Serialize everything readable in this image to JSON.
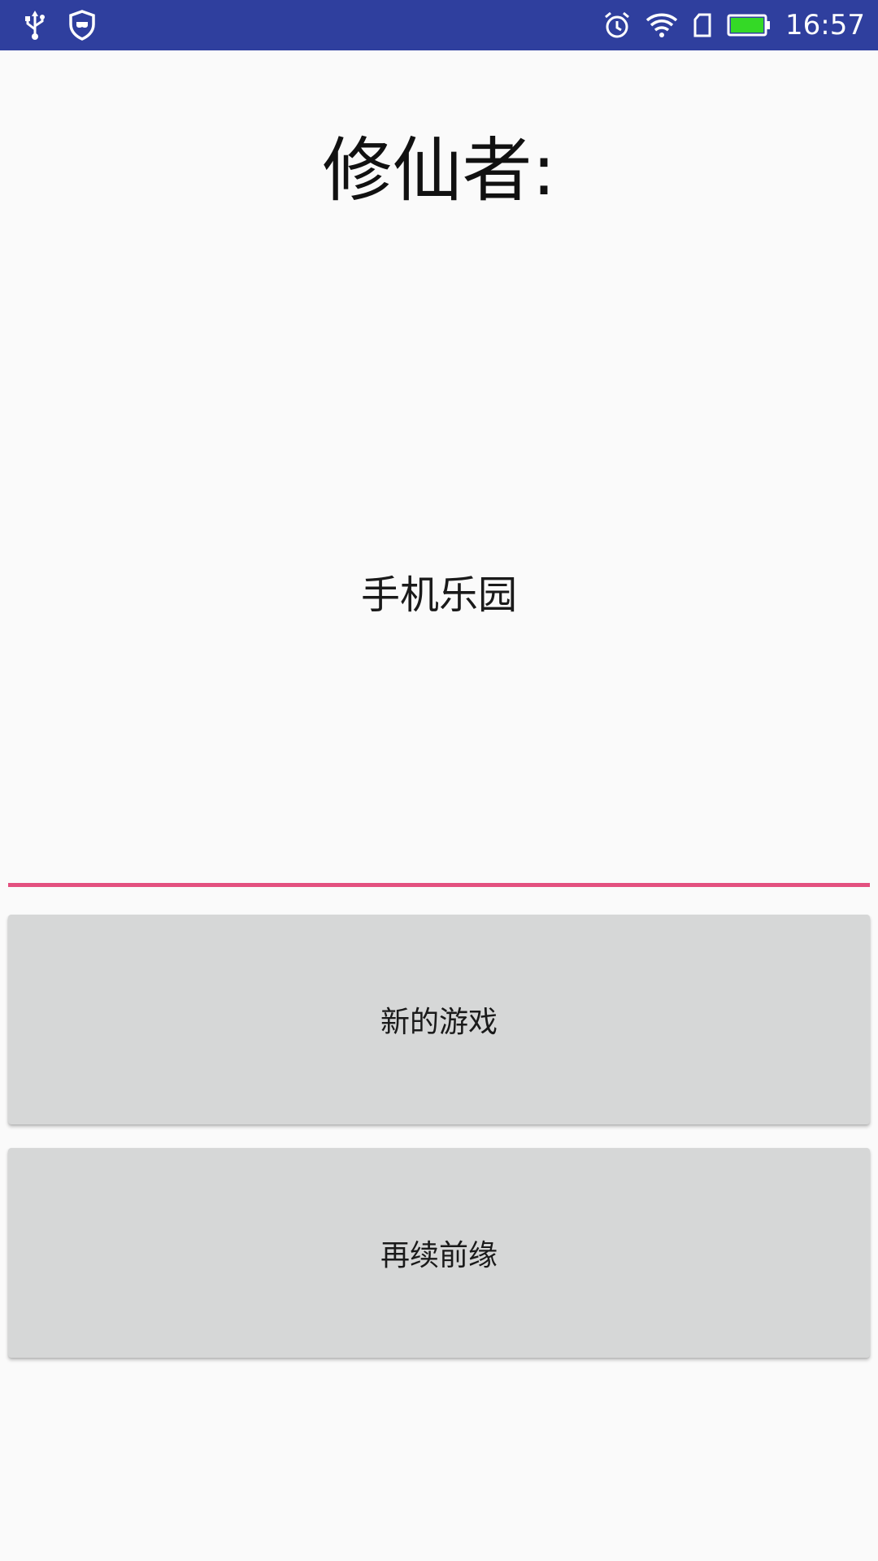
{
  "status_bar": {
    "time": "16:57",
    "background": "#2f3f9e",
    "left_icons": [
      "usb-icon",
      "shield-icon"
    ],
    "right_icons": [
      "alarm-icon",
      "wifi-icon",
      "sim-card-icon",
      "battery-icon"
    ],
    "battery_color": "#34d926"
  },
  "main": {
    "title": "修仙者:",
    "subtitle": "手机乐园",
    "divider_color": "#e3507f"
  },
  "buttons": {
    "new_game": "新的游戏",
    "continue_game": "再续前缘"
  }
}
